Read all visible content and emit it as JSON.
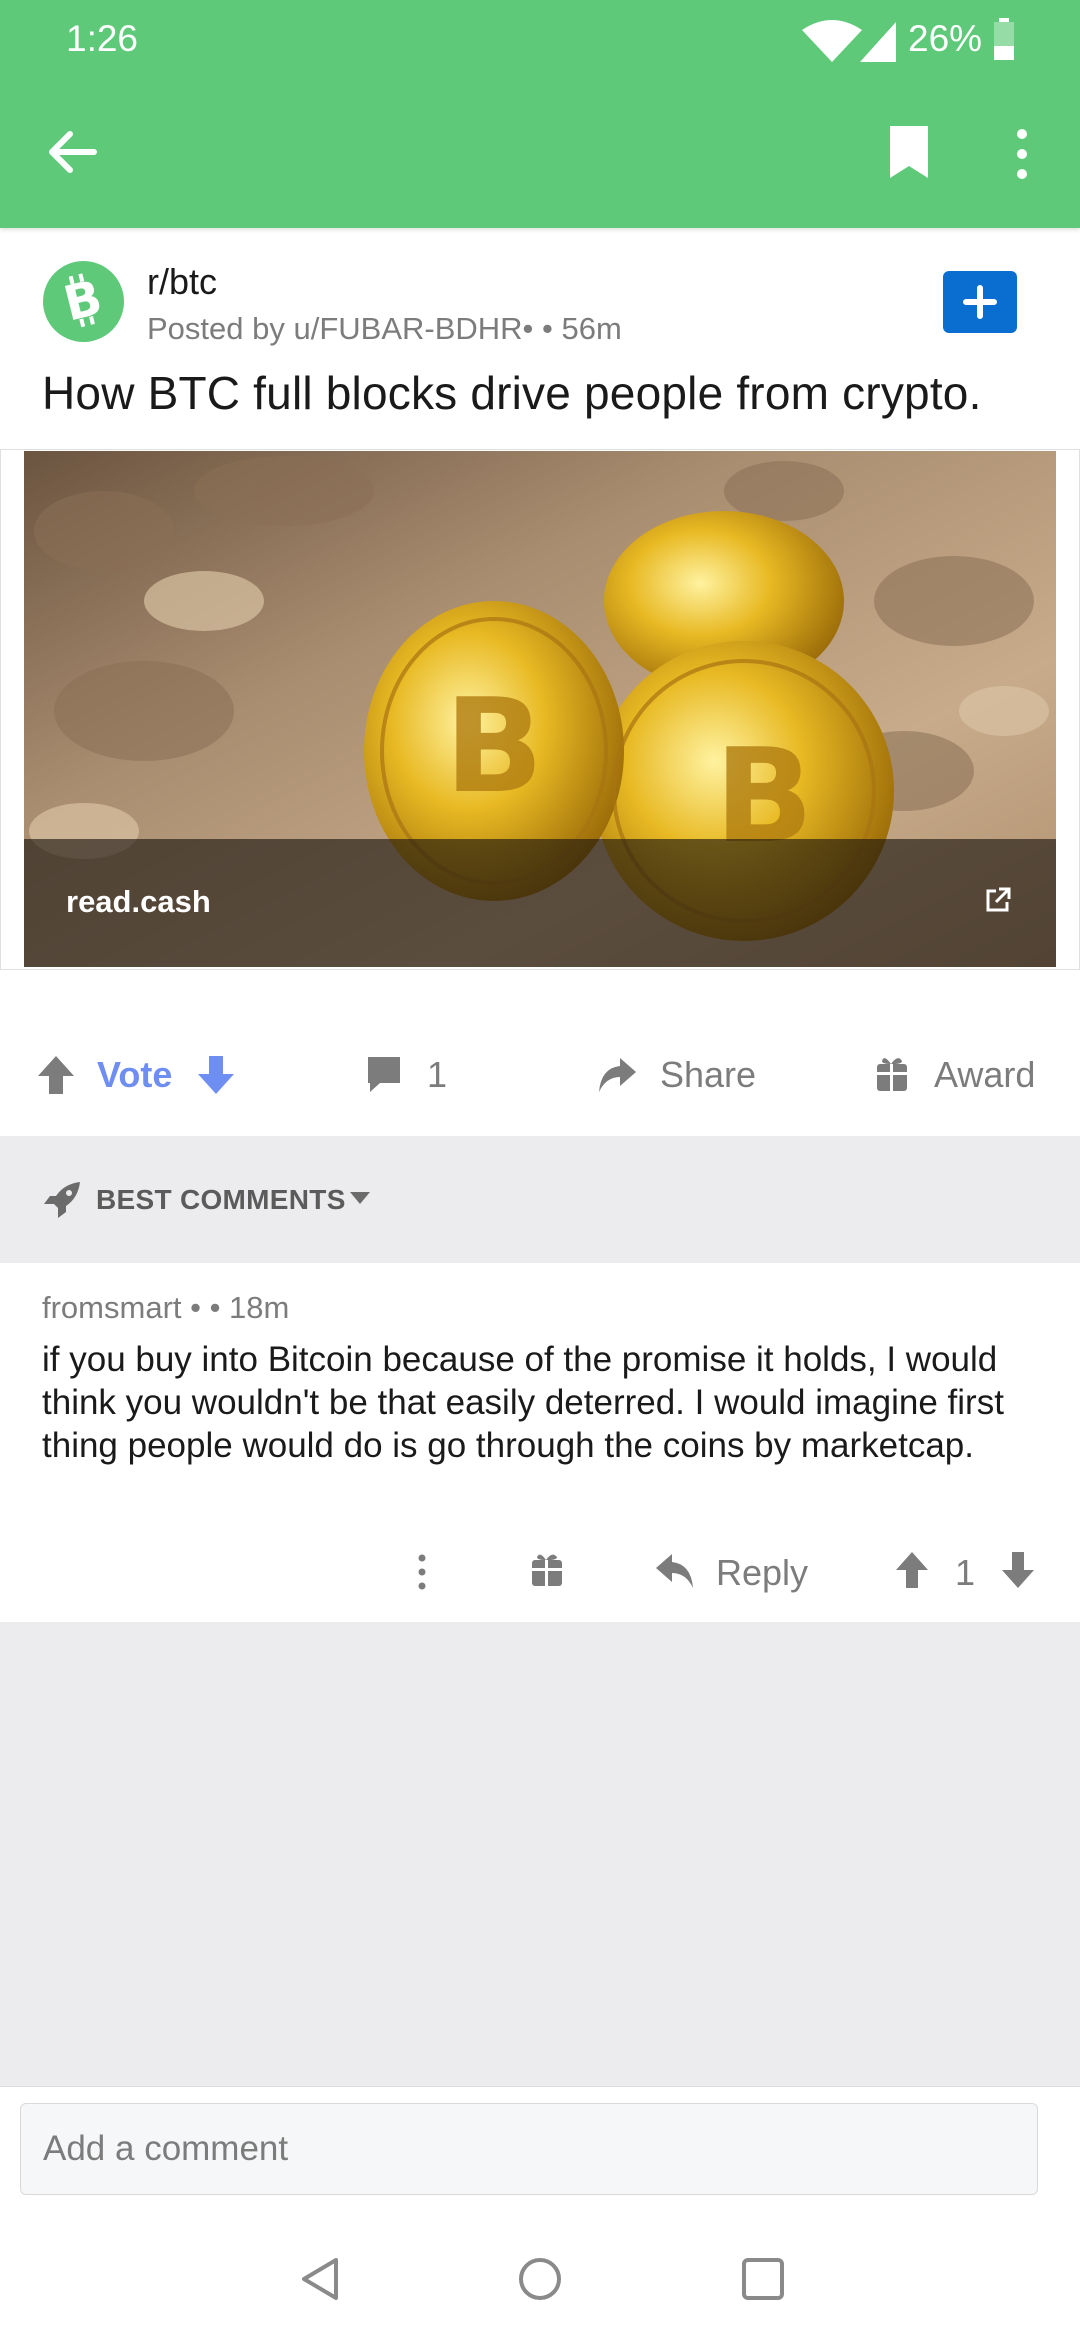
{
  "status_bar": {
    "time": "1:26",
    "battery": "26%"
  },
  "app_bar": {
    "back_icon": "arrow-left-icon",
    "bookmark_icon": "bookmark-icon",
    "menu_icon": "more-vertical-icon"
  },
  "post": {
    "subreddit": "r/btc",
    "posted_by": "Posted by u/FUBAR-BDHR•  • 56m",
    "title": "How BTC full blocks drive people from crypto.",
    "link_domain": "read.cash",
    "join_icon": "plus-icon"
  },
  "actions": {
    "vote_label": "Vote",
    "comment_count": "1",
    "share_label": "Share",
    "award_label": "Award"
  },
  "comments_sort": {
    "label": "BEST COMMENTS"
  },
  "comment": {
    "meta": "fromsmart •  • 18m",
    "body": "if you buy into Bitcoin because of the promise it holds, I would think you wouldn't be that easily deterred. I would imagine first thing people would do is go through the coins by marketcap.",
    "reply_label": "Reply",
    "score": "1"
  },
  "comment_input": {
    "placeholder": "Add a comment"
  },
  "colors": {
    "accent_green": "#5ec979",
    "join_blue": "#0a6ed1",
    "vote_blue": "#6f8ef2",
    "muted_gray": "#7c7c7c",
    "band_gray": "#ececef"
  }
}
